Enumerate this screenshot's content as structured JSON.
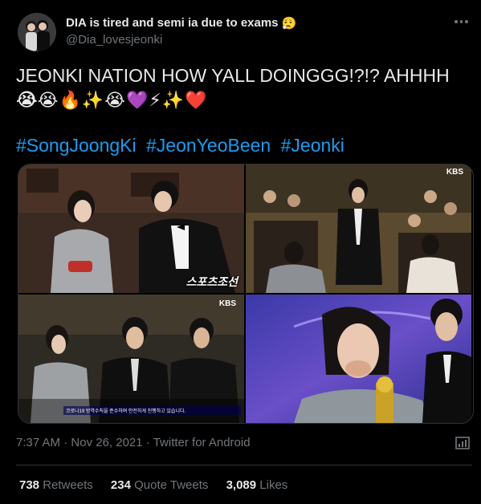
{
  "user": {
    "display_name": "DIA is tired and semi ia due to exams",
    "display_emoji": "😮‍💨",
    "handle": "@Dia_lovesjeonki",
    "avatar_icon": "avatar-photo"
  },
  "tweet": {
    "text": "JEONKI NATION HOW YALL DOINGGG!?!? AHHHH",
    "emojis_line1_end": "😭",
    "emojis_line2": [
      "😭",
      "😭",
      "🔥",
      "✨",
      "😭",
      "💜",
      "⚡",
      "✨",
      "❤️"
    ],
    "hashtags": [
      "#SongJoongKi",
      "#JeonYeoBeen",
      "#Jeonki"
    ]
  },
  "media": {
    "photo1_caption": "스포츠조선",
    "photo2_logo": "KBS",
    "photo3_logo": "KBS",
    "photo3_subtitle": "코로나19 방역수칙을 준수하며 안전하게 진행하고 있습니다."
  },
  "meta": {
    "time": "7:37 AM",
    "separator": " · ",
    "date": "Nov 26, 2021",
    "client": "Twitter for Android"
  },
  "stats": {
    "retweets_count": "738",
    "retweets_label": "Retweets",
    "quotes_count": "234",
    "quotes_label": "Quote Tweets",
    "likes_count": "3,089",
    "likes_label": "Likes"
  },
  "colors": {
    "background": "#000000",
    "text": "#e7e9ea",
    "secondary": "#71767b",
    "link": "#1d9bf0",
    "border": "#2f3336"
  }
}
